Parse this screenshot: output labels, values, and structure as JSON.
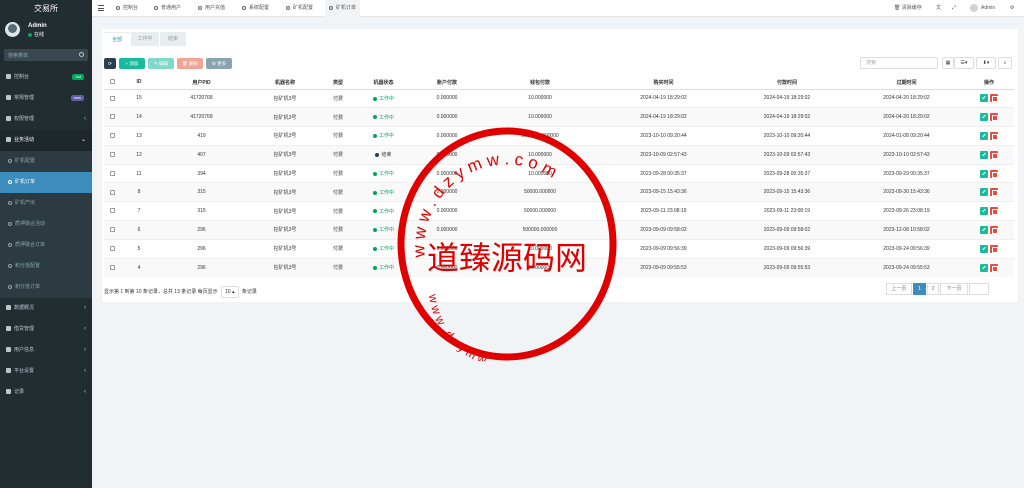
{
  "brand": "交易所",
  "user": {
    "name": "Admin",
    "status": "在线"
  },
  "sidebar": {
    "search_placeholder": "搜索菜单",
    "items": [
      {
        "label": "控制台",
        "badge": "hot",
        "badge_color": "#00a65a"
      },
      {
        "label": "常规管理",
        "badge": "new",
        "badge_color": "#605ca8"
      },
      {
        "label": "权限管理"
      },
      {
        "label": "业务活动"
      }
    ],
    "sub_items": [
      {
        "label": "矿机配置"
      },
      {
        "label": "矿机订单"
      },
      {
        "label": "矿机产出"
      },
      {
        "label": "质押融合活动"
      },
      {
        "label": "质押融合订单"
      },
      {
        "label": "积分抵配置"
      },
      {
        "label": "积分抵订单"
      }
    ],
    "items_bottom": [
      {
        "label": "数据概况"
      },
      {
        "label": "借贷管理"
      },
      {
        "label": "用户信息"
      },
      {
        "label": "平台设置"
      },
      {
        "label": "记录"
      }
    ]
  },
  "topbar": {
    "tabs": [
      {
        "label": "控制台",
        "icon": "dashboard-icon"
      },
      {
        "label": "普通用户",
        "icon": "user-icon"
      },
      {
        "label": "用户充值",
        "icon": "circle-icon"
      },
      {
        "label": "系统配置",
        "icon": "circle-icon"
      },
      {
        "label": "矿机配置",
        "icon": "circle-icon"
      },
      {
        "label": "矿机订单",
        "icon": "circle-icon"
      }
    ],
    "clear_cache": "清除缓存",
    "admin_label": "Admin"
  },
  "subtabs": [
    "全部",
    "工作中",
    "结束"
  ],
  "toolbar": {
    "add": "添加",
    "edit": "编辑",
    "delete": "删除",
    "more": "更多",
    "search_placeholder": "搜索"
  },
  "table": {
    "headers": [
      "ID",
      "用户PID",
      "机器名称",
      "类型",
      "机器状态",
      "账户付款",
      "钱包付款",
      "购买时间",
      "付款时间",
      "过期时间",
      "操作"
    ],
    "rows": [
      [
        "15",
        "41720768",
        "挖矿机3号",
        "付费",
        "工作中",
        "0.000000",
        "10.000000",
        "2024-04-19 18:29:02",
        "2024-04-19 18:29:02",
        "2024-04-20 18:29:02"
      ],
      [
        "14",
        "41720768",
        "挖矿机3号",
        "付费",
        "工作中",
        "0.000000",
        "10.000000",
        "2024-04-19 18:29:02",
        "2024-04-19 18:29:02",
        "2024-04-20 18:29:02"
      ],
      [
        "13",
        "419",
        "挖矿机3号",
        "付费",
        "工作中",
        "0.000000",
        "5000000.000000",
        "2023-10-10 09:20:44",
        "2023-10-10 09:20:44",
        "2024-01-08 09:20:44"
      ],
      [
        "12",
        "407",
        "挖矿机3号",
        "付费",
        "结束",
        "0.000000",
        "10.000000",
        "2023-10-09 02:57:43",
        "2023-10-09 02:57:43",
        "2023-10-10 02:57:43"
      ],
      [
        "11",
        "394",
        "挖矿机3号",
        "付费",
        "工作中",
        "0.000000",
        "10.000000",
        "2023-09-28 00:35:37",
        "2023-09-28 00:35:37",
        "2023-09-29 00:35:37"
      ],
      [
        "8",
        "315",
        "挖矿机3号",
        "付费",
        "工作中",
        "0.000000",
        "50000.000000",
        "2023-09-15 15:43:36",
        "2023-09-15 15:43:36",
        "2023-09-30 15:43:36"
      ],
      [
        "7",
        "315",
        "挖矿机3号",
        "付费",
        "工作中",
        "0.000000",
        "50000.000000",
        "2023-09-11 23:08:19",
        "2023-09-11 23:08:19",
        "2023-09-26 23:08:19"
      ],
      [
        "6",
        "296",
        "挖矿机3号",
        "付费",
        "工作中",
        "0.000000",
        "500000.000000",
        "2023-09-09 09:58:02",
        "2023-09-09 09:58:02",
        "2023-12-08 10:58:02"
      ],
      [
        "5",
        "296",
        "挖矿机3号",
        "付费",
        "工作中",
        "0.000000",
        "10.000000",
        "2023-09-09 09:56:39",
        "2023-09-09 09:56:39",
        "2023-09-24 09:56:39"
      ],
      [
        "4",
        "296",
        "挖矿机3号",
        "付费",
        "工作中",
        "0.000000",
        "10.000000",
        "2023-09-09 09:55:53",
        "2023-09-09 09:55:53",
        "2023-09-24 09:55:53"
      ]
    ]
  },
  "pagination": {
    "info_a": "显示第 1 到第 10 条记录，总共 13 条记录 每页显示",
    "page_size": "10",
    "info_b": "条记录",
    "prev": "上一页",
    "pages": [
      "1",
      "2"
    ],
    "next": "下一页"
  },
  "watermark": {
    "title": "道臻源码网",
    "ring_top": "w w w . d z y m w . c o m",
    "ring_bottom": "w w w . d z y m w . c o m"
  },
  "colors": {
    "sidebar_bg": "#222d32",
    "primary": "#3c8dbc",
    "success": "#18bc9c",
    "danger": "#e74c3c",
    "warning_muted": "#8aa4af",
    "stamp": "#e00000"
  }
}
